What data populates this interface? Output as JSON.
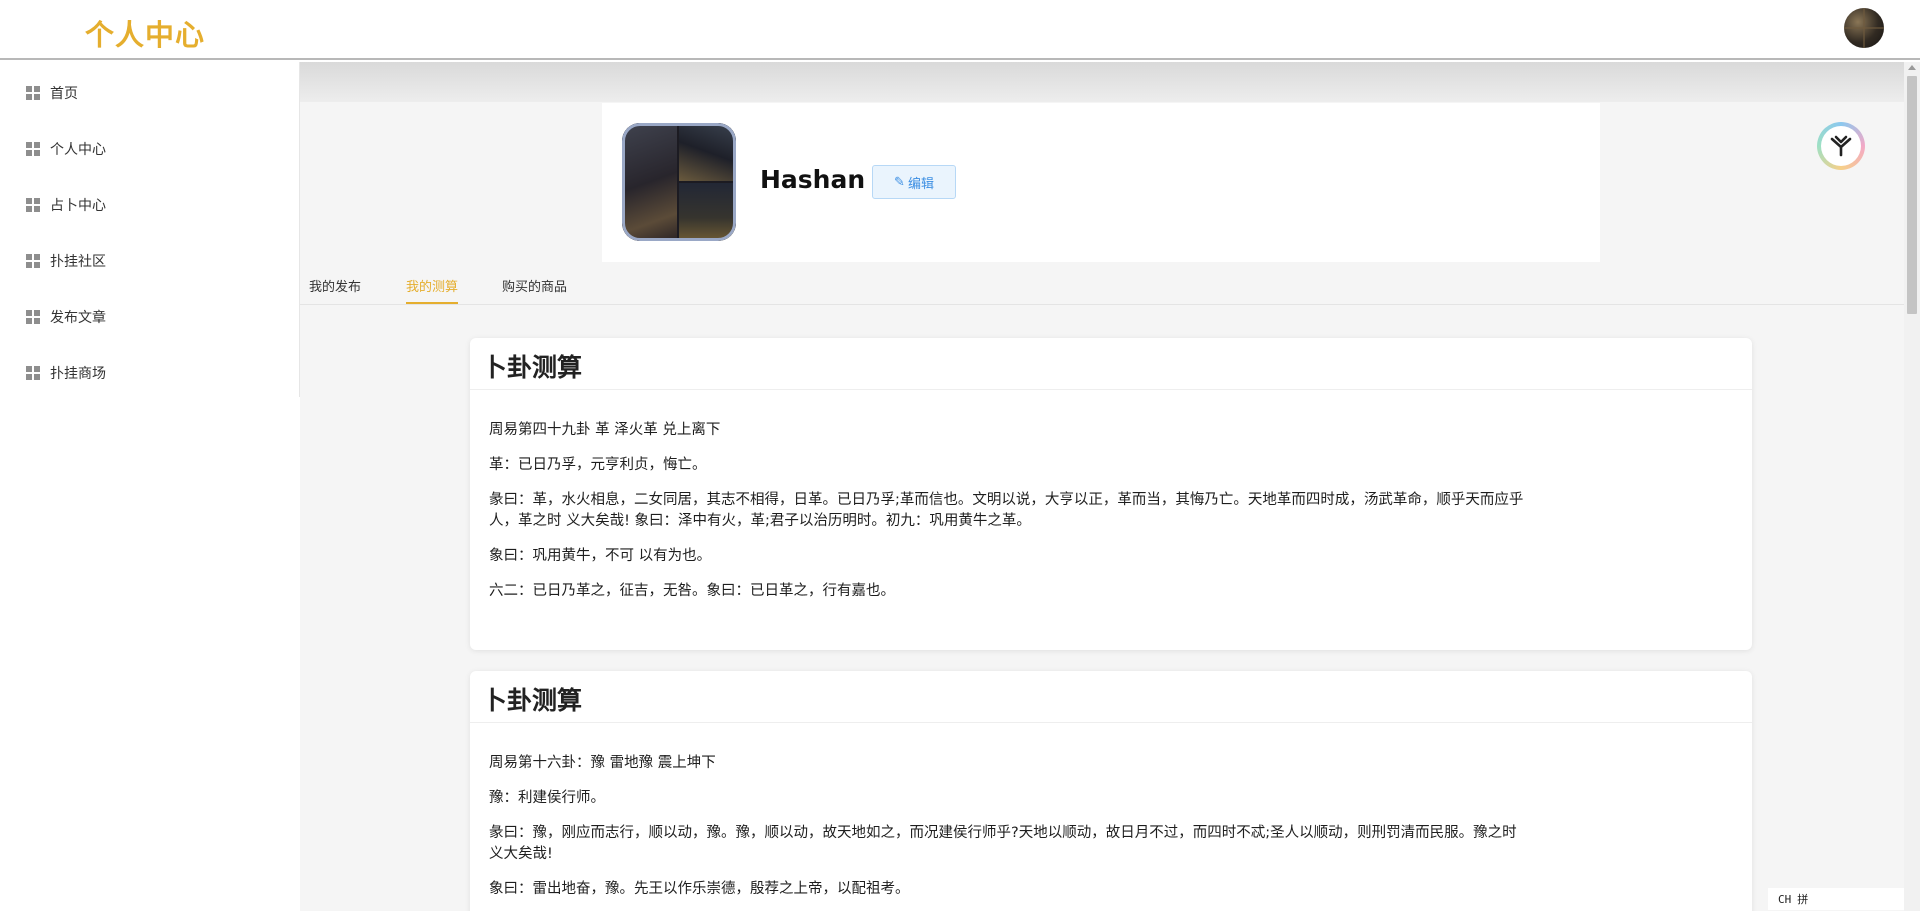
{
  "header": {
    "title": "个人中心"
  },
  "sidebar": {
    "items": [
      {
        "label": "首页"
      },
      {
        "label": "个人中心"
      },
      {
        "label": "占卜中心"
      },
      {
        "label": "扑挂社区"
      },
      {
        "label": "发布文章"
      },
      {
        "label": "扑挂商场"
      }
    ]
  },
  "profile": {
    "name": "Hashan",
    "edit_label": "编辑",
    "edit_icon": "pen-icon"
  },
  "tabs": [
    {
      "label": "我的发布",
      "active": false
    },
    {
      "label": "我的测算",
      "active": true
    },
    {
      "label": "购买的商品",
      "active": false
    }
  ],
  "cards": [
    {
      "title": "卜卦测算",
      "paragraphs": [
        "周易第四十九卦 革 泽火革 兑上离下",
        "革：已日乃孚，元亨利贞，悔亡。",
        "彖曰：革，水火相息，二女同居，其志不相得，日革。已日乃孚;革而信也。文明以说，大亨以正，革而当，其悔乃亡。天地革而四时成，汤武革命，顺乎天而应乎人，革之时 义大矣哉! 象曰：泽中有火，革;君子以治历明时。初九：巩用黄牛之革。",
        "象曰：巩用黄牛，不可 以有为也。",
        "六二：已日乃革之，征吉，无咎。象曰：已日革之，行有嘉也。"
      ]
    },
    {
      "title": "卜卦测算",
      "paragraphs": [
        "周易第十六卦：豫 雷地豫 震上坤下",
        "豫：利建侯行师。",
        "彖曰：豫，刚应而志行，顺以动，豫。豫，顺以动，故天地如之，而况建侯行师乎?天地以顺动，故日月不过，而四时不忒;圣人以顺动，则刑罚清而民服。豫之时义大矣哉!",
        "象曰：雷出地奋，豫。先王以作乐崇德，殷荐之上帝，以配祖考。"
      ]
    }
  ],
  "ime": {
    "lang": "CH",
    "mode": "拼"
  },
  "colors": {
    "accent": "#e5ae2e",
    "edit_blue": "#3d8fe3"
  }
}
